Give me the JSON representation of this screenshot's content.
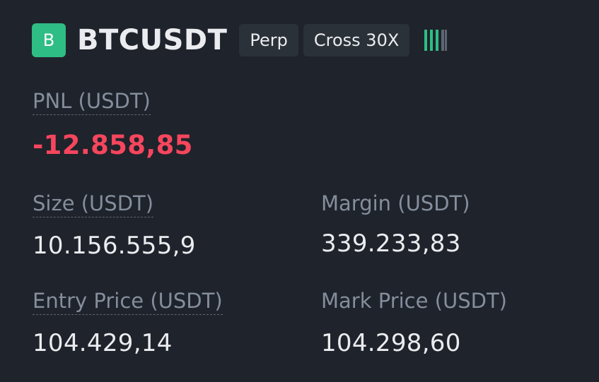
{
  "position": {
    "symbol_badge": "B",
    "symbol": "BTCUSDT",
    "tags": [
      "Perp",
      "Cross 30X"
    ],
    "signal_icon": "signal-strength-icon",
    "pnl": {
      "label": "PNL (USDT)",
      "value": "-12.858,85"
    },
    "size": {
      "label": "Size (USDT)",
      "value": "10.156.555,9"
    },
    "margin": {
      "label": "Margin (USDT)",
      "value": "339.233,83"
    },
    "entry_price": {
      "label": "Entry Price (USDT)",
      "value": "104.429,14"
    },
    "mark_price": {
      "label": "Mark Price (USDT)",
      "value": "104.298,60"
    }
  },
  "colors": {
    "background": "#1f232b",
    "badge": "#2ebd85",
    "loss": "#f6465d",
    "label": "#848e9c",
    "value": "#eaecef",
    "tag_bg": "#2b3139"
  }
}
